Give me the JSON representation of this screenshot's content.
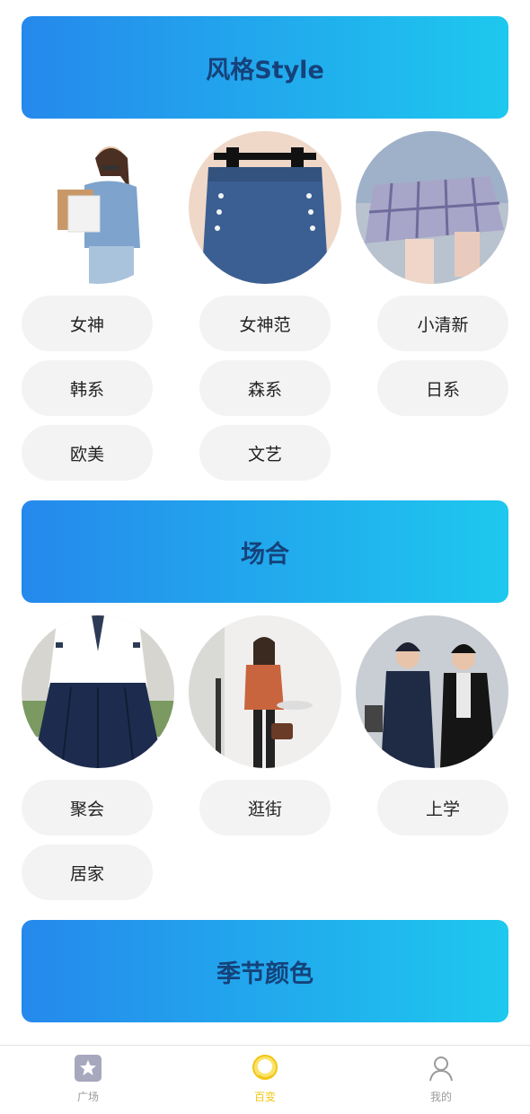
{
  "sections": [
    {
      "title": "风格Style",
      "tags": [
        "女神",
        "女神范",
        "小清新",
        "韩系",
        "森系",
        "日系",
        "欧美",
        "文艺"
      ]
    },
    {
      "title": "场合",
      "tags": [
        "聚会",
        "逛街",
        "上学",
        "居家"
      ]
    },
    {
      "title": "季节颜色"
    }
  ],
  "tabbar": {
    "items": [
      {
        "label": "广场",
        "icon": "star-square-icon"
      },
      {
        "label": "百变",
        "icon": "chat-bubble-icon"
      },
      {
        "label": "我的",
        "icon": "user-icon"
      }
    ],
    "active_index": 1
  },
  "colors": {
    "header_gradient_start": "#2589ec",
    "header_gradient_end": "#1ec8ee",
    "header_text": "#15427a",
    "pill_bg": "#f3f3f3",
    "active_tab": "#f3c514",
    "inactive_tab": "#9a9a9a"
  }
}
